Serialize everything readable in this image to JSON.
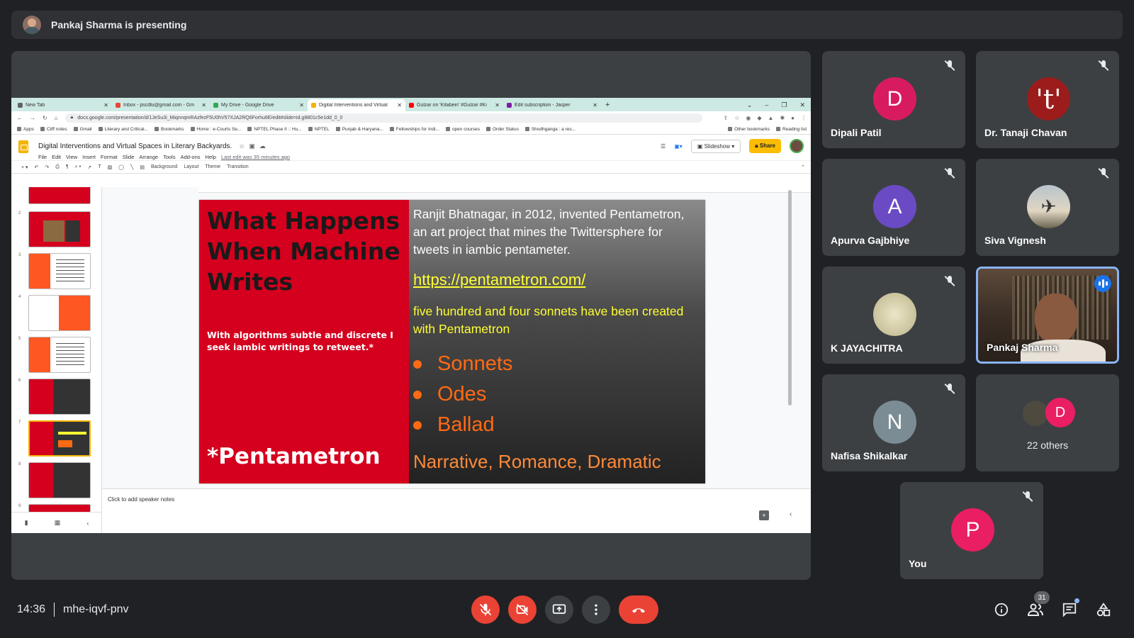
{
  "meeting": {
    "presenting_label": "Pankaj Sharma is presenting",
    "time": "14:36",
    "code": "mhe-iqvf-pnv",
    "participant_count": "31"
  },
  "browser": {
    "tabs": [
      {
        "label": "New Tab",
        "color": "#5f6368"
      },
      {
        "label": "Inbox - pscdlu@gmail.com - Gm",
        "color": "#ea4335"
      },
      {
        "label": "My Drive - Google Drive",
        "color": "#34a853"
      },
      {
        "label": "Digital Interventions and Virtual",
        "color": "#f4b400"
      },
      {
        "label": "Gulzar on 'Kitabein' #Gulzar #Ki",
        "color": "#ff0000"
      },
      {
        "label": "Edit subscription - Jasper",
        "color": "#7b1fa2"
      }
    ],
    "url": "docs.google.com/presentation/d/1JeSu3i_MiqnnqmRAzfezF5U0hV57XJA2RQ6Forhu6E/edit#slide=id.g8801c5e1dd_0_0",
    "bookmarks": [
      "Apps",
      "Cliff notes",
      "Gmail",
      "Literary and Critical...",
      "Bookmarks",
      "Home : e-Courts Se...",
      "NPTEL Phase II :: Hu...",
      "NPTEL",
      "Punjab & Haryana...",
      "Fellowships for Indi...",
      "open courses",
      "Order Status",
      "Shodhganga : a res...",
      "Other bookmarks",
      "Reading list"
    ]
  },
  "doc": {
    "title": "Digital Interventions and Virtual Spaces in Literary Backyards.",
    "menus": [
      "File",
      "Edit",
      "View",
      "Insert",
      "Format",
      "Slide",
      "Arrange",
      "Tools",
      "Add-ons",
      "Help"
    ],
    "last_edit": "Last edit was 35 minutes ago",
    "slideshow_label": "Slideshow",
    "share_label": "Share",
    "toolbar": [
      "Background",
      "Layout",
      "Theme",
      "Transition"
    ],
    "notes_placeholder": "Click to add speaker notes"
  },
  "slide": {
    "title": "What Happens When Machine Writes",
    "quote": "With algorithms subtle and discrete I seek iambic writings to retweet.*",
    "footnote": "*Pentametron",
    "body": "Ranjit Bhatnagar, in 2012,  invented Pentametron, an art project that mines the Twittersphere for tweets in iambic pentameter.",
    "link": "https://pentametron.com/",
    "highlight": "five hundred and four sonnets have been created with Pentametron",
    "bullets": [
      "Sonnets",
      "Odes",
      "Ballad"
    ],
    "genres": "Narrative, Romance, Dramatic"
  },
  "thumbnails": {
    "numbers": [
      "2",
      "3",
      "4",
      "5",
      "6",
      "7",
      "8",
      "9"
    ],
    "selected_number": "7"
  },
  "participants": [
    {
      "name": "Dipali Patil",
      "initial": "D",
      "color": "#d81b60"
    },
    {
      "name": "Dr. Tanaji Chavan",
      "initial": "'t'",
      "color": "#9c1c1c"
    },
    {
      "name": "Apurva Gajbhiye",
      "initial": "A",
      "color": "#6a4bc4"
    },
    {
      "name": "Siva Vignesh",
      "initial": "",
      "color": "#c9c2b0"
    },
    {
      "name": "K JAYACHITRA",
      "initial": "",
      "color": "#d8d2b4"
    },
    {
      "name": "Pankaj Sharma",
      "initial": "",
      "color": "#5d4a3a"
    },
    {
      "name": "Nafisa Shikalkar",
      "initial": "N",
      "color": "#7b8c94"
    },
    {
      "name": "You",
      "initial": "P",
      "color": "#e91e63"
    }
  ],
  "others": {
    "label": "22 others",
    "initial": "D",
    "color": "#e91e63"
  },
  "icons": {
    "mic_off": "mic-off-icon",
    "cam_off": "camera-off-icon",
    "present": "present-screen-icon",
    "more": "more-vert-icon",
    "hangup": "call-end-icon",
    "info": "info-icon",
    "people": "people-icon",
    "chat": "chat-icon",
    "activities": "activities-icon"
  }
}
